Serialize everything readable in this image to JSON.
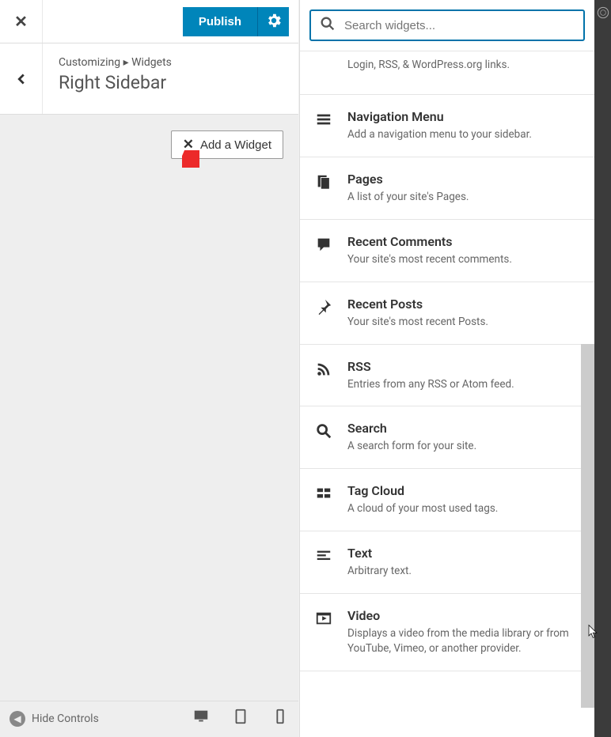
{
  "topBar": {
    "publish": "Publish"
  },
  "header": {
    "breadcrumb": "Customizing ▸ Widgets",
    "title": "Right Sidebar"
  },
  "addWidget": "Add a Widget",
  "bottomBar": {
    "hideControls": "Hide Controls"
  },
  "search": {
    "placeholder": "Search widgets..."
  },
  "widgets": [
    {
      "title": "",
      "desc": "Login, RSS, & WordPress.org links.",
      "icon": ""
    },
    {
      "title": "Navigation Menu",
      "desc": "Add a navigation menu to your sidebar.",
      "icon": "menu"
    },
    {
      "title": "Pages",
      "desc": "A list of your site's Pages.",
      "icon": "pages"
    },
    {
      "title": "Recent Comments",
      "desc": "Your site's most recent comments.",
      "icon": "comment"
    },
    {
      "title": "Recent Posts",
      "desc": "Your site's most recent Posts.",
      "icon": "pin"
    },
    {
      "title": "RSS",
      "desc": "Entries from any RSS or Atom feed.",
      "icon": "rss"
    },
    {
      "title": "Search",
      "desc": "A search form for your site.",
      "icon": "search"
    },
    {
      "title": "Tag Cloud",
      "desc": "A cloud of your most used tags.",
      "icon": "tags"
    },
    {
      "title": "Text",
      "desc": "Arbitrary text.",
      "icon": "text"
    },
    {
      "title": "Video",
      "desc": "Displays a video from the media library or from YouTube, Vimeo, or another provider.",
      "icon": "video"
    }
  ]
}
